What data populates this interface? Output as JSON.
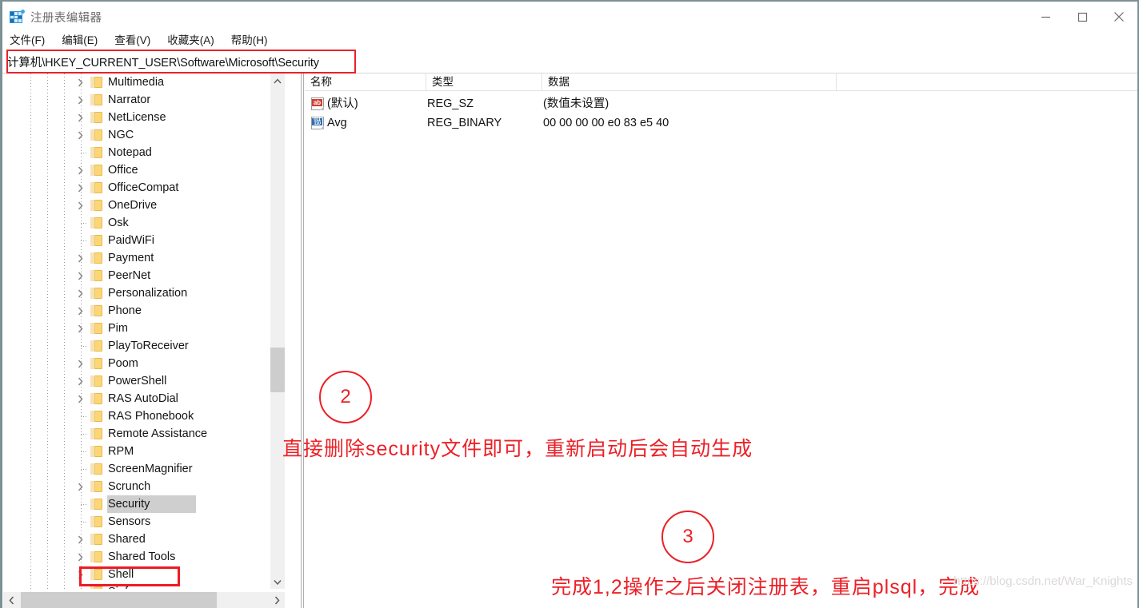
{
  "window": {
    "title": "注册表编辑器",
    "icon": "registry-editor-icon",
    "minimize_label": "—",
    "maximize_label": "□",
    "close_label": "✕"
  },
  "menubar": {
    "items": [
      {
        "label": "文件(F)"
      },
      {
        "label": "编辑(E)"
      },
      {
        "label": "查看(V)"
      },
      {
        "label": "收藏夹(A)"
      },
      {
        "label": "帮助(H)"
      }
    ]
  },
  "address": {
    "value": "计算机\\HKEY_CURRENT_USER\\Software\\Microsoft\\Security",
    "highlight_color": "#e8222a"
  },
  "tree": {
    "nodes": [
      {
        "label": "Multimedia",
        "expandable": true,
        "selected": false
      },
      {
        "label": "Narrator",
        "expandable": true,
        "selected": false
      },
      {
        "label": "NetLicense",
        "expandable": true,
        "selected": false
      },
      {
        "label": "NGC",
        "expandable": true,
        "selected": false
      },
      {
        "label": "Notepad",
        "expandable": false,
        "selected": false
      },
      {
        "label": "Office",
        "expandable": true,
        "selected": false
      },
      {
        "label": "OfficeCompat",
        "expandable": true,
        "selected": false
      },
      {
        "label": "OneDrive",
        "expandable": true,
        "selected": false
      },
      {
        "label": "Osk",
        "expandable": false,
        "selected": false
      },
      {
        "label": "PaidWiFi",
        "expandable": false,
        "selected": false
      },
      {
        "label": "Payment",
        "expandable": true,
        "selected": false
      },
      {
        "label": "PeerNet",
        "expandable": true,
        "selected": false
      },
      {
        "label": "Personalization",
        "expandable": true,
        "selected": false
      },
      {
        "label": "Phone",
        "expandable": true,
        "selected": false
      },
      {
        "label": "Pim",
        "expandable": true,
        "selected": false
      },
      {
        "label": "PlayToReceiver",
        "expandable": false,
        "selected": false
      },
      {
        "label": "Poom",
        "expandable": true,
        "selected": false
      },
      {
        "label": "PowerShell",
        "expandable": true,
        "selected": false
      },
      {
        "label": "RAS AutoDial",
        "expandable": true,
        "selected": false
      },
      {
        "label": "RAS Phonebook",
        "expandable": false,
        "selected": false
      },
      {
        "label": "Remote Assistance",
        "expandable": false,
        "selected": false
      },
      {
        "label": "RPM",
        "expandable": false,
        "selected": false
      },
      {
        "label": "ScreenMagnifier",
        "expandable": false,
        "selected": false
      },
      {
        "label": "Scrunch",
        "expandable": true,
        "selected": false
      },
      {
        "label": "Security",
        "expandable": false,
        "selected": true
      },
      {
        "label": "Sensors",
        "expandable": false,
        "selected": false
      },
      {
        "label": "Shared",
        "expandable": true,
        "selected": false
      },
      {
        "label": "Shared Tools",
        "expandable": true,
        "selected": false
      },
      {
        "label": "Shell",
        "expandable": true,
        "selected": false
      },
      {
        "label": "Sinf",
        "expandable": false,
        "selected": false
      }
    ],
    "selected_highlight_color": "#cfcfcf",
    "selected_outline_color": "#ed1c24"
  },
  "values": {
    "columns": [
      "名称",
      "类型",
      "数据",
      ""
    ],
    "rows": [
      {
        "icon": "string-value-icon",
        "name": "(默认)",
        "type": "REG_SZ",
        "data": "(数值未设置)"
      },
      {
        "icon": "binary-value-icon",
        "name": "Avg",
        "type": "REG_BINARY",
        "data": "00 00 00 00 e0 83 e5 40"
      }
    ]
  },
  "annotations": {
    "step2_number": "2",
    "step2_text": "直接删除security文件即可，重新启动后会自动生成",
    "step3_number": "3",
    "step3_text": "完成1,2操作之后关闭注册表，重启plsql，完成",
    "color": "#ec2027"
  },
  "watermark": {
    "text": "https://blog.csdn.net/War_Knights"
  },
  "scrollbars": {
    "tree_vertical": {
      "up_arrow": "▲",
      "down_arrow": "▼"
    },
    "tree_horizontal": {
      "left_arrow": "◀",
      "right_arrow": "▶"
    }
  }
}
